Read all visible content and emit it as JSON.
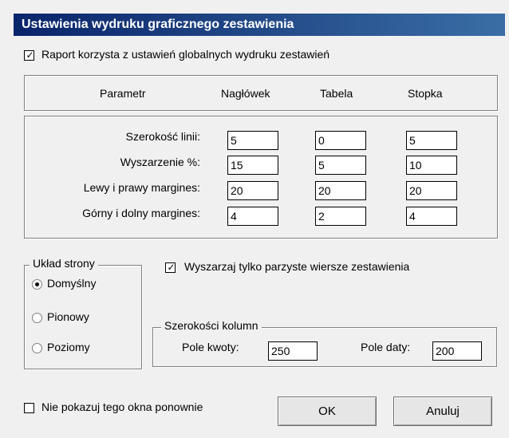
{
  "window": {
    "title": "Ustawienia wydruku graficznego zestawienia"
  },
  "global_checkbox": {
    "label": "Raport korzysta z ustawień globalnych wydruku zestawień",
    "checked": true
  },
  "params_header": {
    "param": "Parametr",
    "header": "Nagłówek",
    "table": "Tabela",
    "footer": "Stopka"
  },
  "rows": [
    {
      "label": "Szerokość linii:",
      "header": "5",
      "table": "0",
      "footer": "5"
    },
    {
      "label": "Wyszarzenie %:",
      "header": "15",
      "table": "5",
      "footer": "10"
    },
    {
      "label": "Lewy i prawy margines:",
      "header": "20",
      "table": "20",
      "footer": "20"
    },
    {
      "label": "Górny i dolny margines:",
      "header": "4",
      "table": "2",
      "footer": "4"
    }
  ],
  "layout_group": {
    "title": "Układ strony",
    "options": [
      "Domyślny",
      "Pionowy",
      "Poziomy"
    ],
    "selected": "Domyślny"
  },
  "even_rows_checkbox": {
    "label": "Wyszarzaj tylko parzyste wiersze zestawienia",
    "checked": true
  },
  "columns_group": {
    "title": "Szerokości kolumn",
    "amount_label": "Pole kwoty:",
    "amount_value": "250",
    "date_label": "Pole daty:",
    "date_value": "200"
  },
  "dont_show_checkbox": {
    "label": "Nie pokazuj tego okna ponownie",
    "checked": false
  },
  "buttons": {
    "ok": "OK",
    "cancel": "Anuluj"
  },
  "colors": {
    "title_bg": "#0a246a",
    "dialog_bg": "#f0f0f0"
  }
}
